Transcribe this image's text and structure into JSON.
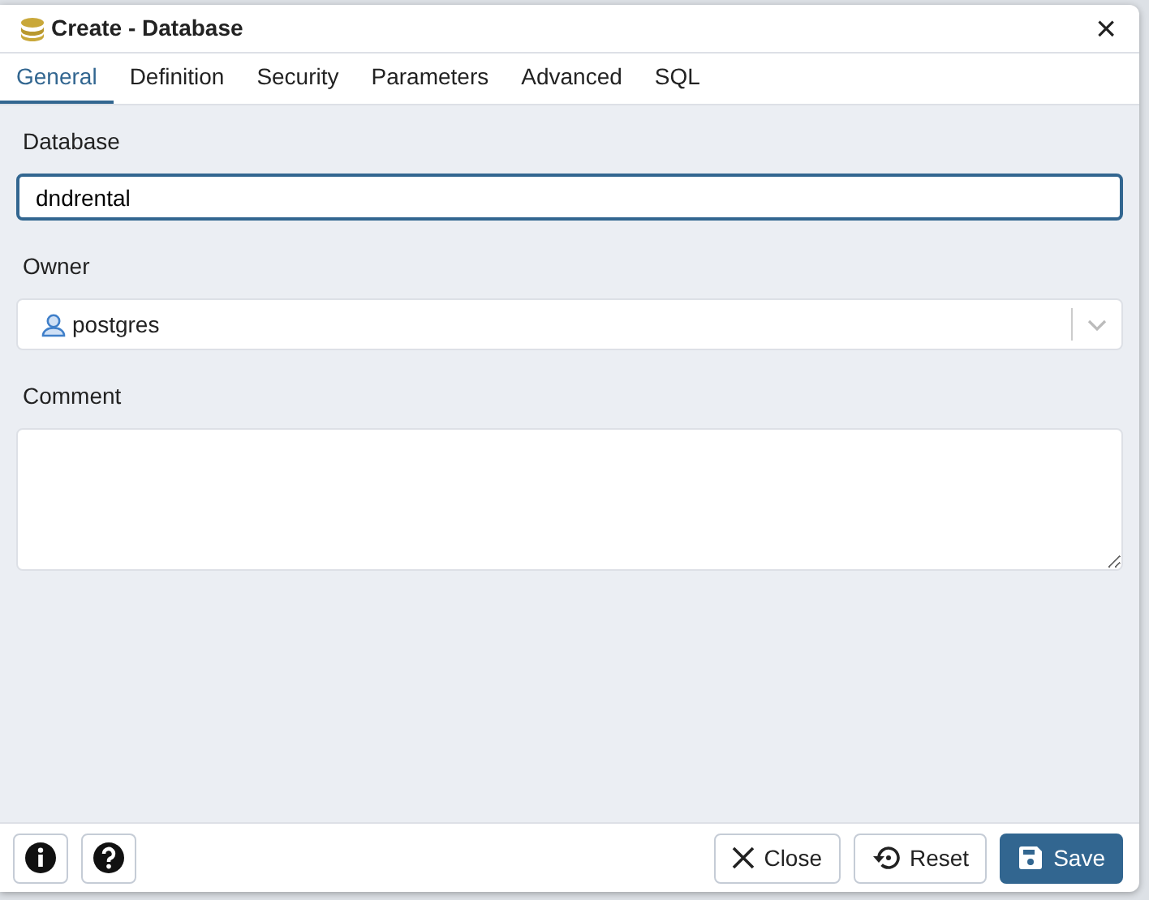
{
  "dialog": {
    "title": "Create - Database",
    "close_symbol": "×"
  },
  "tabs": [
    {
      "label": "General",
      "selected": true
    },
    {
      "label": "Definition",
      "selected": false
    },
    {
      "label": "Security",
      "selected": false
    },
    {
      "label": "Parameters",
      "selected": false
    },
    {
      "label": "Advanced",
      "selected": false
    },
    {
      "label": "SQL",
      "selected": false
    }
  ],
  "fields": [
    {
      "kind": "text",
      "label": "Database",
      "value": "dndrental",
      "focused": true
    },
    {
      "kind": "select",
      "label": "Owner",
      "value": "postgres"
    },
    {
      "kind": "textarea",
      "label": "Comment"
    }
  ],
  "footer": {
    "left_buttons": [
      {
        "kind": "info"
      },
      {
        "kind": "help"
      }
    ],
    "right_buttons": [
      {
        "kind": "close",
        "label": "Close",
        "primary": false
      },
      {
        "kind": "reset",
        "label": "Reset",
        "primary": false
      },
      {
        "kind": "save",
        "label": "Save",
        "primary": true
      }
    ]
  }
}
